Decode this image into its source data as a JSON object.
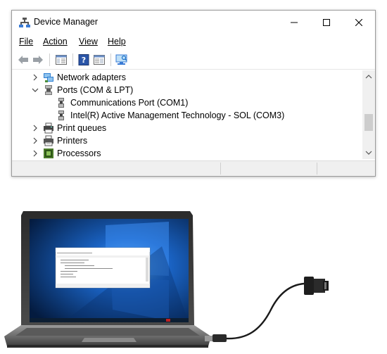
{
  "window": {
    "title": "Device Manager",
    "controls": [
      "minimize",
      "maximize",
      "close"
    ]
  },
  "menu": {
    "file": "File",
    "action": "Action",
    "view": "View",
    "help": "Help"
  },
  "toolbar": {
    "buttons": [
      "back-icon",
      "forward-icon",
      "properties-pane-icon",
      "help-icon",
      "update-driver-icon",
      "scan-hardware-icon"
    ]
  },
  "tree": {
    "nodes": [
      {
        "label": "Network adapters",
        "expanded": false,
        "level": 0,
        "icon": "network-adapter-icon"
      },
      {
        "label": "Ports (COM & LPT)",
        "expanded": true,
        "level": 0,
        "icon": "port-icon"
      },
      {
        "label": "Communications Port (COM1)",
        "level": 1,
        "icon": "port-device-icon"
      },
      {
        "label": "Intel(R) Active Management Technology - SOL (COM3)",
        "level": 1,
        "icon": "port-device-icon"
      },
      {
        "label": "Print queues",
        "expanded": false,
        "level": 0,
        "icon": "printer-queue-icon"
      },
      {
        "label": "Printers",
        "expanded": false,
        "level": 0,
        "icon": "printer-icon"
      },
      {
        "label": "Processors",
        "expanded": false,
        "level": 0,
        "icon": "processor-icon"
      }
    ]
  },
  "illustration": {
    "subject": "laptop with USB-to-serial adapter cable"
  },
  "colors": {
    "accent_blue": "#1e72c8",
    "scroll_thumb": "#cdcdcd",
    "screen_bg": "#0b3c7a"
  }
}
